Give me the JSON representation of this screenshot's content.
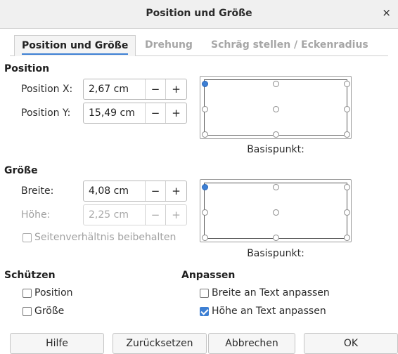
{
  "window": {
    "title": "Position und Größe",
    "close_glyph": "×"
  },
  "tabs": [
    {
      "label": "Position und Größe",
      "active": true
    },
    {
      "label": "Drehung",
      "active": false
    },
    {
      "label": "Schräg stellen / Eckenradius",
      "active": false
    }
  ],
  "position": {
    "heading": "Position",
    "x": {
      "label": "Position X:",
      "value": "2,67 cm"
    },
    "y": {
      "label": "Position Y:",
      "value": "15,49 cm"
    },
    "basis_caption": "Basispunkt:"
  },
  "size": {
    "heading": "Größe",
    "width": {
      "label": "Breite:",
      "value": "4,08 cm"
    },
    "height": {
      "label": "Höhe:",
      "value": "2,25 cm"
    },
    "keep_ratio": {
      "label": "Seitenverhältnis beibehalten",
      "checked": false
    },
    "basis_caption": "Basispunkt:"
  },
  "spin": {
    "minus": "−",
    "plus": "+"
  },
  "protect": {
    "heading": "Schützen",
    "position": {
      "label": "Position",
      "checked": false
    },
    "size": {
      "label": "Größe",
      "checked": false
    }
  },
  "adapt": {
    "heading": "Anpassen",
    "fit_width": {
      "label": "Breite an Text anpassen",
      "checked": false
    },
    "fit_height": {
      "label": "Höhe an Text anpassen",
      "checked": true
    }
  },
  "buttons": {
    "help": "Hilfe",
    "reset": "Zurücksetzen",
    "cancel": "Abbrechen",
    "ok": "OK"
  },
  "colors": {
    "accent": "#3d7fd3"
  }
}
